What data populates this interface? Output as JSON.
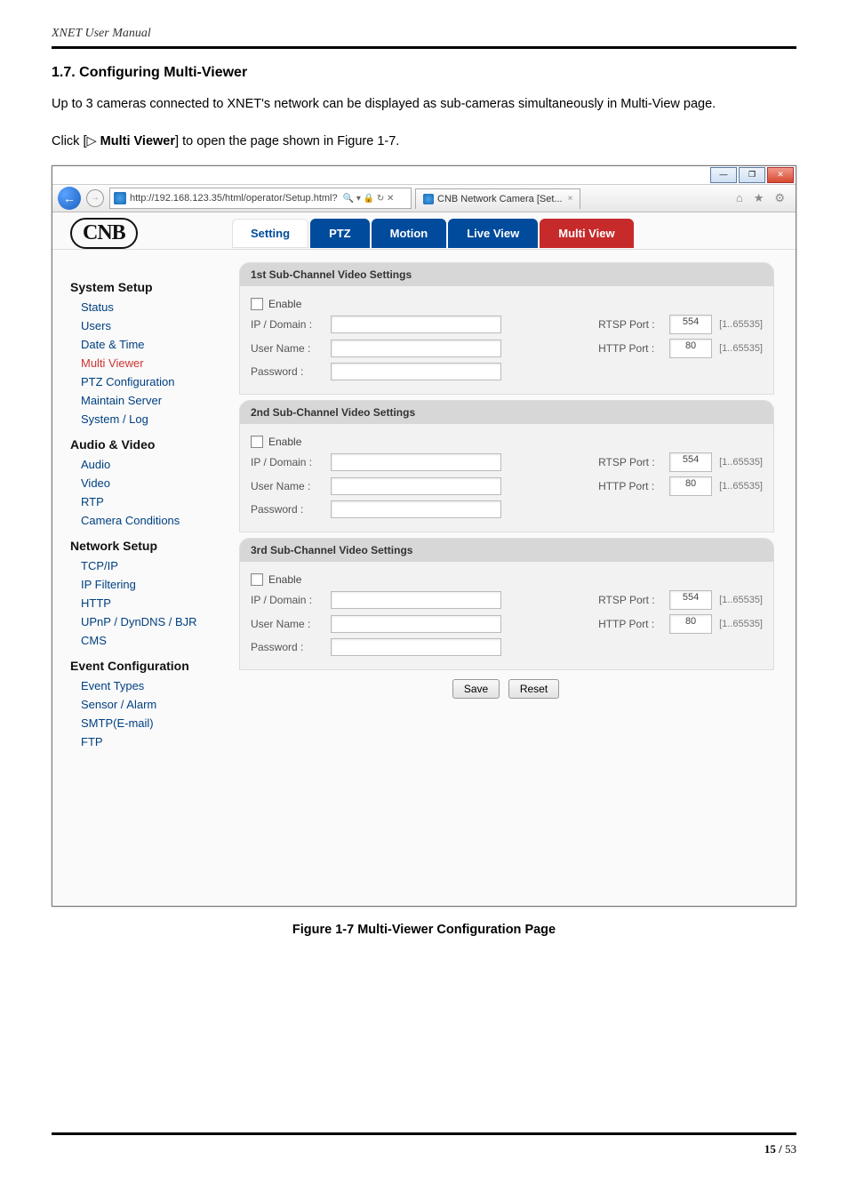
{
  "doc": {
    "header_title": "XNET User Manual",
    "section_num_title": "1.7. Configuring Multi-Viewer",
    "para1": "Up to 3 cameras connected to XNET's network can be displayed as sub-cameras simultaneously in Multi-View page.",
    "click_prefix": "Click [",
    "triangle": "▷",
    "click_bold": " Multi Viewer",
    "click_suffix": "] to open the page shown in Figure 1-7.",
    "figure_caption": "Figure 1-7 Multi-Viewer Configuration Page",
    "page_num_bold": "15 /",
    "page_num_rest": " 53"
  },
  "browser": {
    "url": "http://192.168.123.35/html/operator/Setup.html?",
    "url_suffix_icons": "🔍 ▾  🔒 ↻ ✕",
    "tab_title": "CNB Network Camera [Set...",
    "tab_close": "×",
    "win_min": "—",
    "win_max": "❐",
    "win_close": "✕"
  },
  "app": {
    "brand": "CNB",
    "tabs": {
      "setting": "Setting",
      "ptz": "PTZ",
      "motion": "Motion",
      "live": "Live View",
      "multi": "Multi View"
    }
  },
  "sidebar": {
    "g1": "System Setup",
    "g1items": {
      "status": "Status",
      "users": "Users",
      "date": "Date & Time",
      "multi": "Multi Viewer",
      "ptzc": "PTZ Configuration",
      "maint": "Maintain Server",
      "syslog": "System / Log"
    },
    "g2": "Audio & Video",
    "g2items": {
      "audio": "Audio",
      "video": "Video",
      "rtp": "RTP",
      "camcond": "Camera Conditions"
    },
    "g3": "Network Setup",
    "g3items": {
      "tcpip": "TCP/IP",
      "ipfilt": "IP Filtering",
      "http": "HTTP",
      "upnp": "UPnP / DynDNS / BJR",
      "cms": "CMS"
    },
    "g4": "Event Configuration",
    "g4items": {
      "etypes": "Event Types",
      "sensor": "Sensor / Alarm",
      "smtp": "SMTP(E-mail)",
      "ftp": "FTP"
    }
  },
  "panels": {
    "p1h": "1st Sub-Channel Video Settings",
    "p2h": "2nd Sub-Channel Video Settings",
    "p3h": "3rd Sub-Channel Video Settings",
    "enable": "Enable",
    "ipdomain": "IP / Domain :",
    "username": "User Name :",
    "password": "Password :",
    "rtspport": "RTSP Port :",
    "httpport": "HTTP Port :",
    "rtsp_val": "554",
    "http_val": "80",
    "range": "[1..65535]",
    "save": "Save",
    "reset": "Reset"
  }
}
